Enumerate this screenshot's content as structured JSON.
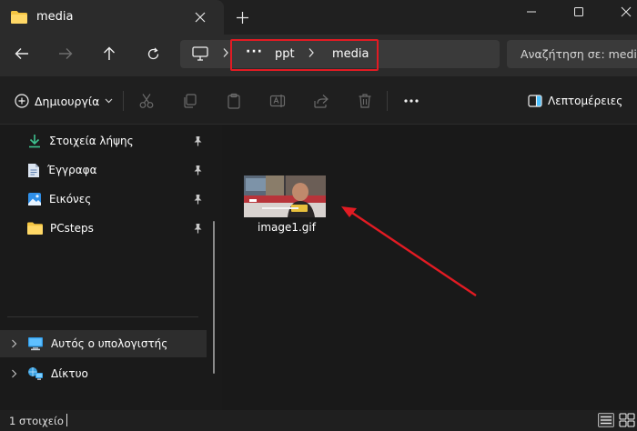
{
  "window": {
    "tab_title": "media",
    "icons": {
      "tab": "folder-icon",
      "tab_close": "close-icon",
      "new_tab": "plus-icon",
      "minimize": "minimize-icon",
      "maximize": "maximize-icon",
      "close": "close-icon"
    }
  },
  "address": {
    "ellipsis": "···",
    "crumbs": [
      "ppt",
      "media"
    ],
    "search_placeholder": "Αναζήτηση σε: media",
    "highlight_color": "#e21b23"
  },
  "toolbar": {
    "new_label": "Δημιουργία",
    "details_label": "Λεπτομέρειες",
    "icons": [
      "cut-icon",
      "copy-icon",
      "paste-icon",
      "rename-icon",
      "share-icon",
      "delete-icon",
      "more-icon"
    ]
  },
  "sidebar": {
    "quick_access": [
      {
        "label": "Στοιχεία λήψης",
        "icon": "download-icon",
        "pinned": true
      },
      {
        "label": "Έγγραφα",
        "icon": "documents-icon",
        "pinned": true
      },
      {
        "label": "Εικόνες",
        "icon": "pictures-icon",
        "pinned": true
      },
      {
        "label": "PCsteps",
        "icon": "folder-icon",
        "pinned": true
      }
    ],
    "tree": [
      {
        "label": "Αυτός ο υπολογιστής",
        "icon": "computer-icon",
        "selected": true
      },
      {
        "label": "Δίκτυο",
        "icon": "network-icon",
        "selected": false
      }
    ]
  },
  "content": {
    "files": [
      {
        "name": "image1.gif",
        "thumbnail": "gif-thumbnail"
      }
    ],
    "annotation_color": "#e21b23"
  },
  "status": {
    "item_count": "1 στοιχείο"
  },
  "colors": {
    "accent_blue": "#4cc2ff",
    "folder_yellow": "#f4c542"
  }
}
